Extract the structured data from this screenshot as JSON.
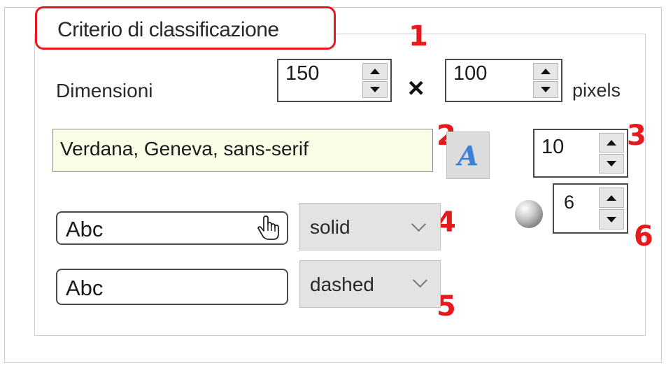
{
  "group": {
    "legend": "Criterio di classificazione"
  },
  "dimensions": {
    "label": "Dimensioni",
    "width": "150",
    "times_symbol": "×",
    "height": "100",
    "unit": "pixels"
  },
  "font": {
    "value": "Verdana, Geneva, sans-serif",
    "picker_glyph": "A",
    "size": "10"
  },
  "opacity": {
    "value": "6"
  },
  "border_rows": [
    {
      "preview_text": "Abc",
      "style": "solid"
    },
    {
      "preview_text": "Abc",
      "style": "dashed"
    }
  ],
  "callouts": [
    "1",
    "2",
    "3",
    "4",
    "5",
    "6"
  ],
  "colors": {
    "callout": "#e8191d",
    "font_field_bg": "#fafde6",
    "font_icon": "#3e7fd6"
  },
  "icons": [
    "spin-up-icon",
    "spin-down-icon",
    "font-picker-icon",
    "hand-cursor-icon",
    "chevron-down-icon",
    "opacity-circle-icon"
  ]
}
